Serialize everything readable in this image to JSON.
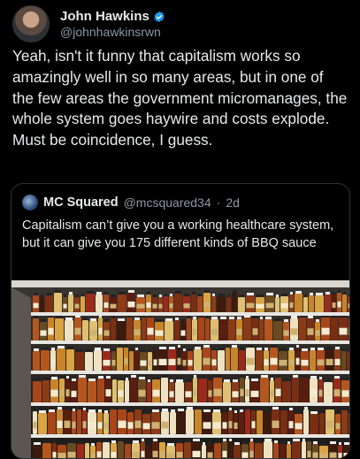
{
  "tweet": {
    "author_name": "John Hawkins",
    "author_handle": "@johnhawkinsrwn",
    "text": "Yeah, isn't it funny that capitalism works so amazingly well in so many areas, but in one of the few areas the government micromanages, the whole system goes haywire and costs explode. Must be coincidence, I guess."
  },
  "quoted_tweet": {
    "author_name": "MC Squared",
    "author_handle": "@mcsquared34",
    "separator": "·",
    "time": "2d",
    "text": "Capitalism can’t give you a working healthcare system, but it can give you 175 different kinds of BBQ sauce"
  },
  "colors": {
    "background": "#000000",
    "text": "#e7e9ea",
    "secondary": "#8b98a5",
    "verified": "#1d9bf0",
    "border": "#2f3336"
  },
  "icons": {
    "verified": "verified-badge-icon"
  }
}
